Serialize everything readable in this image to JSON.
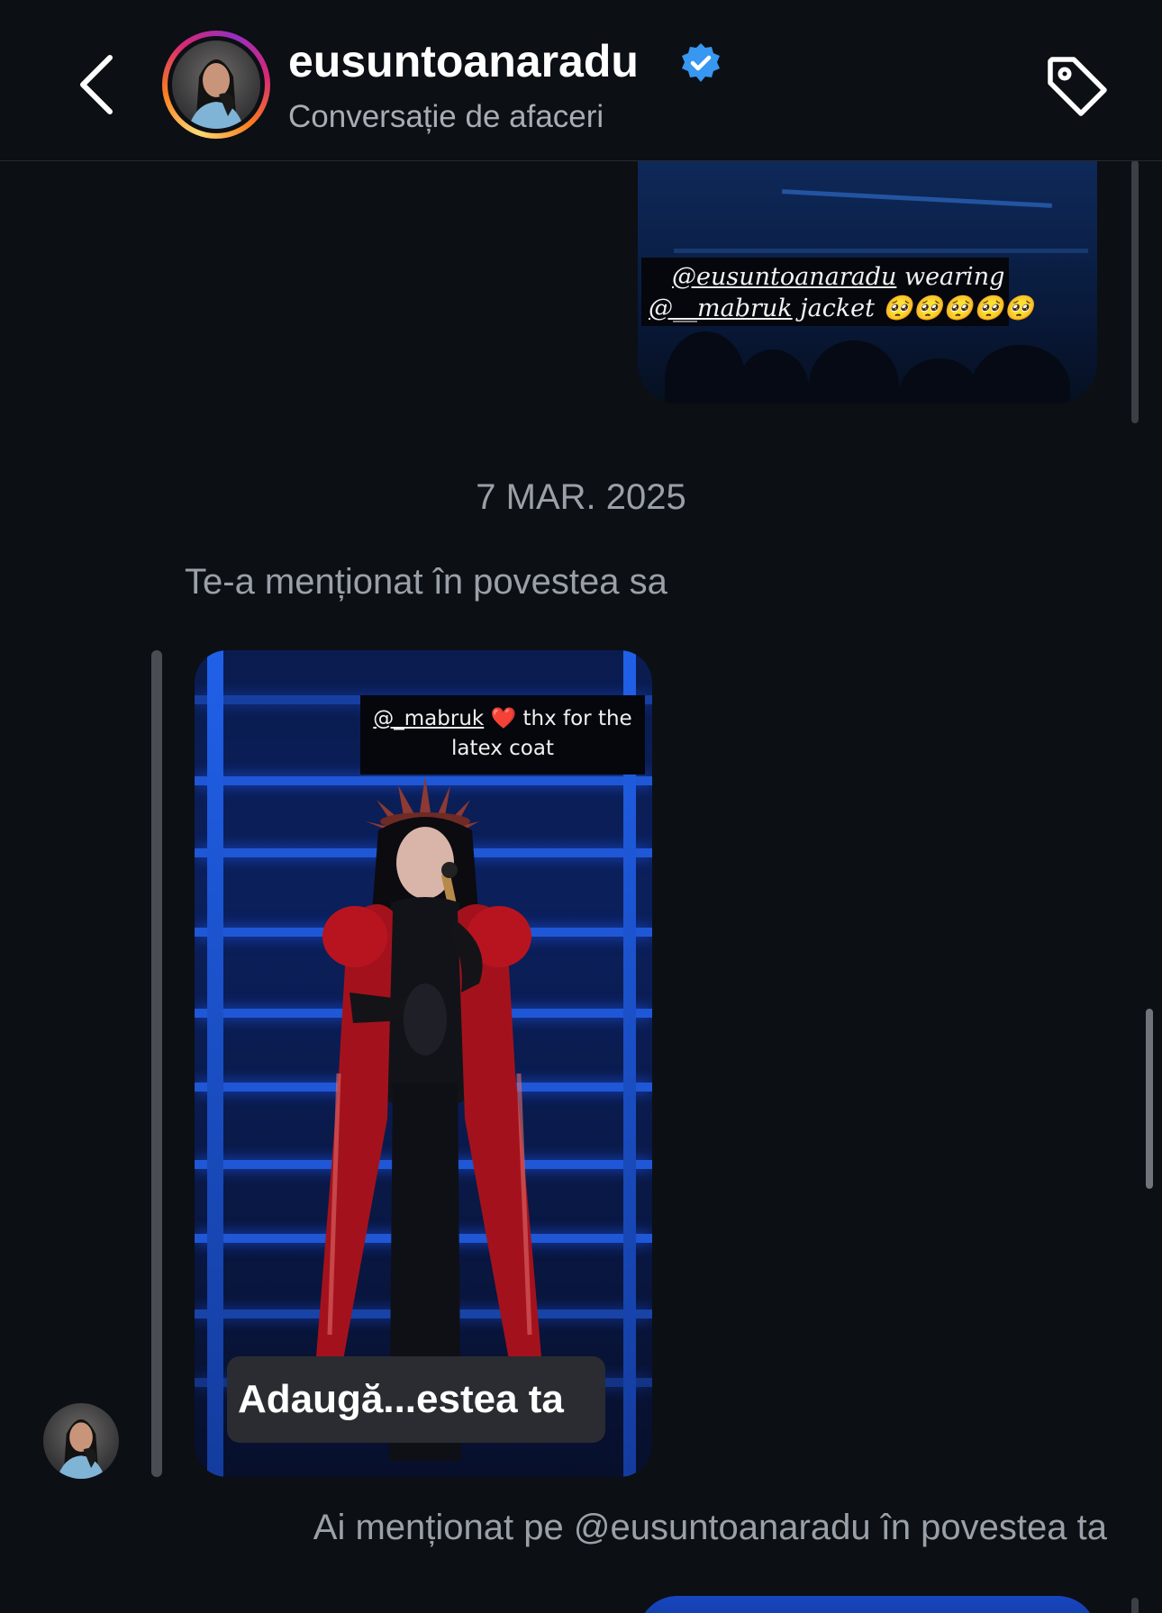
{
  "header": {
    "username": "eusuntoanaradu",
    "subtitle": "Conversație de afaceri",
    "verified": true,
    "back_icon": "chevron-left-icon",
    "tag_icon": "tag-icon"
  },
  "thread": {
    "shared_story_top": {
      "caption_line_1_mention": "@eusuntoanaradu",
      "caption_line_1_rest": "wearing",
      "caption_line_2_mention": "@__mabruk",
      "caption_line_2_rest": "jacket 🥺🥺🥺🥺🥺"
    },
    "date_separator": "7 MAR. 2025",
    "mention_notice": "Te-a menționat în povestea sa",
    "story_main": {
      "caption_mention": "@_mabruk",
      "caption_heart": "❤️",
      "caption_rest_line1": "thx for the",
      "caption_line2": "latex coat",
      "add_button_label": "Adaugă...estea ta"
    },
    "you_mentioned_notice": "Ai menționat pe @eusuntoanaradu în povestea ta"
  },
  "colors": {
    "background": "#0c0f14",
    "verified_badge": "#3897f0",
    "muted_text": "#9aa0a8",
    "coat_red": "#b3121f"
  }
}
